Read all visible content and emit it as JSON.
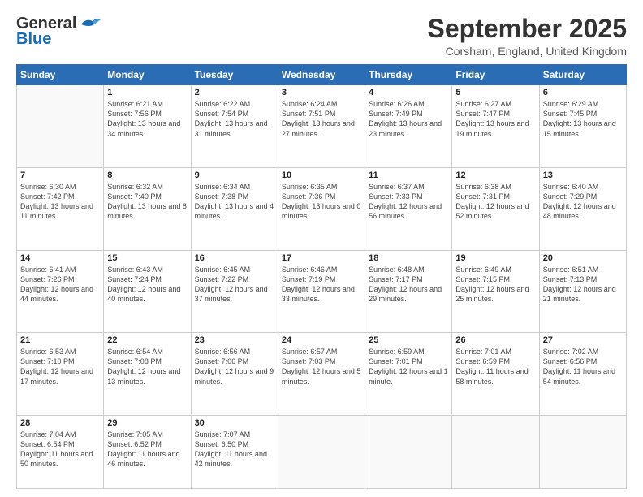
{
  "header": {
    "logo_line1": "General",
    "logo_line2": "Blue",
    "month_title": "September 2025",
    "location": "Corsham, England, United Kingdom"
  },
  "weekdays": [
    "Sunday",
    "Monday",
    "Tuesday",
    "Wednesday",
    "Thursday",
    "Friday",
    "Saturday"
  ],
  "weeks": [
    [
      {
        "day": null
      },
      {
        "day": 1,
        "sunrise": "6:21 AM",
        "sunset": "7:56 PM",
        "daylight": "13 hours and 34 minutes."
      },
      {
        "day": 2,
        "sunrise": "6:22 AM",
        "sunset": "7:54 PM",
        "daylight": "13 hours and 31 minutes."
      },
      {
        "day": 3,
        "sunrise": "6:24 AM",
        "sunset": "7:51 PM",
        "daylight": "13 hours and 27 minutes."
      },
      {
        "day": 4,
        "sunrise": "6:26 AM",
        "sunset": "7:49 PM",
        "daylight": "13 hours and 23 minutes."
      },
      {
        "day": 5,
        "sunrise": "6:27 AM",
        "sunset": "7:47 PM",
        "daylight": "13 hours and 19 minutes."
      },
      {
        "day": 6,
        "sunrise": "6:29 AM",
        "sunset": "7:45 PM",
        "daylight": "13 hours and 15 minutes."
      }
    ],
    [
      {
        "day": 7,
        "sunrise": "6:30 AM",
        "sunset": "7:42 PM",
        "daylight": "13 hours and 11 minutes."
      },
      {
        "day": 8,
        "sunrise": "6:32 AM",
        "sunset": "7:40 PM",
        "daylight": "13 hours and 8 minutes."
      },
      {
        "day": 9,
        "sunrise": "6:34 AM",
        "sunset": "7:38 PM",
        "daylight": "13 hours and 4 minutes."
      },
      {
        "day": 10,
        "sunrise": "6:35 AM",
        "sunset": "7:36 PM",
        "daylight": "13 hours and 0 minutes."
      },
      {
        "day": 11,
        "sunrise": "6:37 AM",
        "sunset": "7:33 PM",
        "daylight": "12 hours and 56 minutes."
      },
      {
        "day": 12,
        "sunrise": "6:38 AM",
        "sunset": "7:31 PM",
        "daylight": "12 hours and 52 minutes."
      },
      {
        "day": 13,
        "sunrise": "6:40 AM",
        "sunset": "7:29 PM",
        "daylight": "12 hours and 48 minutes."
      }
    ],
    [
      {
        "day": 14,
        "sunrise": "6:41 AM",
        "sunset": "7:26 PM",
        "daylight": "12 hours and 44 minutes."
      },
      {
        "day": 15,
        "sunrise": "6:43 AM",
        "sunset": "7:24 PM",
        "daylight": "12 hours and 40 minutes."
      },
      {
        "day": 16,
        "sunrise": "6:45 AM",
        "sunset": "7:22 PM",
        "daylight": "12 hours and 37 minutes."
      },
      {
        "day": 17,
        "sunrise": "6:46 AM",
        "sunset": "7:19 PM",
        "daylight": "12 hours and 33 minutes."
      },
      {
        "day": 18,
        "sunrise": "6:48 AM",
        "sunset": "7:17 PM",
        "daylight": "12 hours and 29 minutes."
      },
      {
        "day": 19,
        "sunrise": "6:49 AM",
        "sunset": "7:15 PM",
        "daylight": "12 hours and 25 minutes."
      },
      {
        "day": 20,
        "sunrise": "6:51 AM",
        "sunset": "7:13 PM",
        "daylight": "12 hours and 21 minutes."
      }
    ],
    [
      {
        "day": 21,
        "sunrise": "6:53 AM",
        "sunset": "7:10 PM",
        "daylight": "12 hours and 17 minutes."
      },
      {
        "day": 22,
        "sunrise": "6:54 AM",
        "sunset": "7:08 PM",
        "daylight": "12 hours and 13 minutes."
      },
      {
        "day": 23,
        "sunrise": "6:56 AM",
        "sunset": "7:06 PM",
        "daylight": "12 hours and 9 minutes."
      },
      {
        "day": 24,
        "sunrise": "6:57 AM",
        "sunset": "7:03 PM",
        "daylight": "12 hours and 5 minutes."
      },
      {
        "day": 25,
        "sunrise": "6:59 AM",
        "sunset": "7:01 PM",
        "daylight": "12 hours and 1 minute."
      },
      {
        "day": 26,
        "sunrise": "7:01 AM",
        "sunset": "6:59 PM",
        "daylight": "11 hours and 58 minutes."
      },
      {
        "day": 27,
        "sunrise": "7:02 AM",
        "sunset": "6:56 PM",
        "daylight": "11 hours and 54 minutes."
      }
    ],
    [
      {
        "day": 28,
        "sunrise": "7:04 AM",
        "sunset": "6:54 PM",
        "daylight": "11 hours and 50 minutes."
      },
      {
        "day": 29,
        "sunrise": "7:05 AM",
        "sunset": "6:52 PM",
        "daylight": "11 hours and 46 minutes."
      },
      {
        "day": 30,
        "sunrise": "7:07 AM",
        "sunset": "6:50 PM",
        "daylight": "11 hours and 42 minutes."
      },
      {
        "day": null
      },
      {
        "day": null
      },
      {
        "day": null
      },
      {
        "day": null
      }
    ]
  ],
  "cell_labels": {
    "sunrise": "Sunrise:",
    "sunset": "Sunset:",
    "daylight": "Daylight:"
  }
}
